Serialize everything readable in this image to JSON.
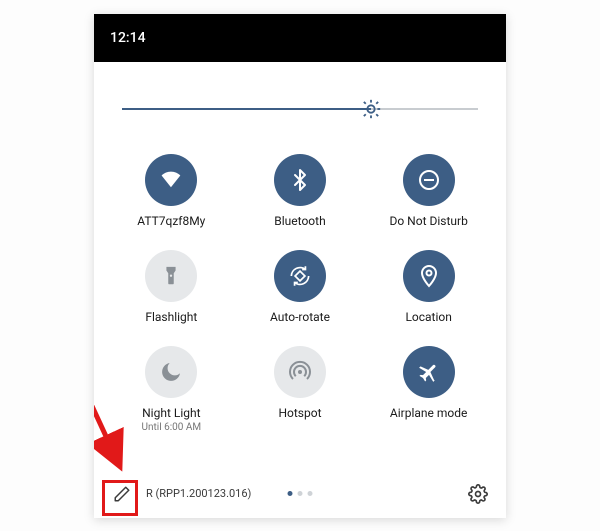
{
  "status": {
    "time": "12:14"
  },
  "brightness": {
    "value_pct": 70
  },
  "tiles": {
    "wifi": {
      "label": "ATT7qzf8My",
      "on": true
    },
    "bluetooth": {
      "label": "Bluetooth",
      "on": true
    },
    "dnd": {
      "label": "Do Not Disturb",
      "on": true
    },
    "flashlight": {
      "label": "Flashlight",
      "on": false
    },
    "autorotate": {
      "label": "Auto-rotate",
      "on": true
    },
    "location": {
      "label": "Location",
      "on": true
    },
    "nightlight": {
      "label": "Night Light",
      "sub": "Until 6:00 AM",
      "on": false
    },
    "hotspot": {
      "label": "Hotspot",
      "on": false
    },
    "airplane": {
      "label": "Airplane mode",
      "on": true
    }
  },
  "footer": {
    "build": "R (RPP1.200123.016)",
    "page_index": 0,
    "page_count": 3
  },
  "colors": {
    "accent": "#3d5e85",
    "tile_off_bg": "#e6e8ea",
    "annotation": "#e11919"
  }
}
